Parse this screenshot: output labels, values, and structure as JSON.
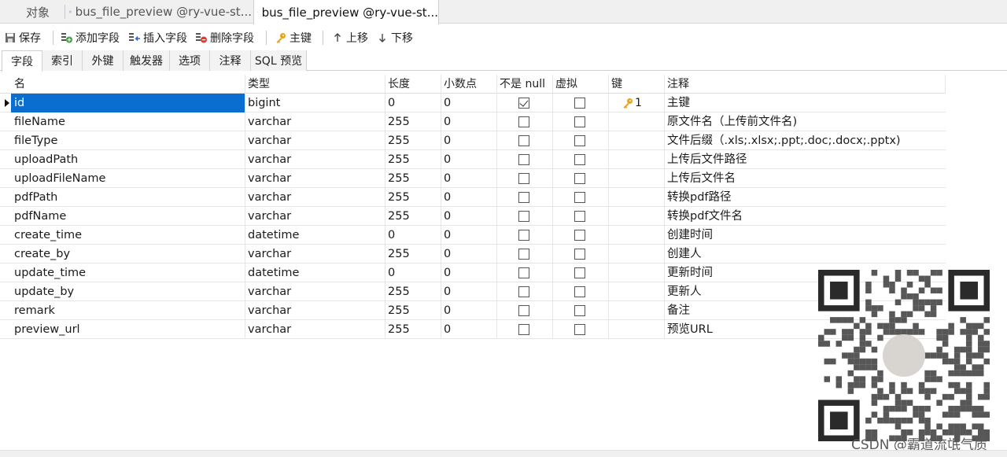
{
  "doc_tabs": [
    {
      "label": "对象",
      "icon": "none"
    },
    {
      "label": "bus_file_preview @ry-vue-st...",
      "icon": "table-icon"
    },
    {
      "label": "bus_file_preview @ry-vue-st...",
      "icon": "table-edit-icon"
    }
  ],
  "toolbar": {
    "save": "保存",
    "add_field": "添加字段",
    "insert_field": "插入字段",
    "delete_field": "删除字段",
    "primary_key": "主键",
    "move_up": "上移",
    "move_down": "下移"
  },
  "section_tabs": [
    "字段",
    "索引",
    "外键",
    "触发器",
    "选项",
    "注释",
    "SQL 预览"
  ],
  "grid": {
    "headers": [
      "名",
      "类型",
      "长度",
      "小数点",
      "不是 null",
      "虚拟",
      "键",
      "注释"
    ],
    "rows": [
      {
        "name": "id",
        "type": "bigint",
        "length": "0",
        "decimals": "0",
        "not_null": true,
        "virtual": false,
        "key": "1",
        "comment": "主键"
      },
      {
        "name": "fileName",
        "type": "varchar",
        "length": "255",
        "decimals": "0",
        "not_null": false,
        "virtual": false,
        "key": "",
        "comment": "原文件名（上传前文件名)"
      },
      {
        "name": "fileType",
        "type": "varchar",
        "length": "255",
        "decimals": "0",
        "not_null": false,
        "virtual": false,
        "key": "",
        "comment": "文件后缀（.xls;.xlsx;.ppt;.doc;.docx;.pptx)"
      },
      {
        "name": "uploadPath",
        "type": "varchar",
        "length": "255",
        "decimals": "0",
        "not_null": false,
        "virtual": false,
        "key": "",
        "comment": "上传后文件路径"
      },
      {
        "name": "uploadFileName",
        "type": "varchar",
        "length": "255",
        "decimals": "0",
        "not_null": false,
        "virtual": false,
        "key": "",
        "comment": "上传后文件名"
      },
      {
        "name": "pdfPath",
        "type": "varchar",
        "length": "255",
        "decimals": "0",
        "not_null": false,
        "virtual": false,
        "key": "",
        "comment": "转换pdf路径"
      },
      {
        "name": "pdfName",
        "type": "varchar",
        "length": "255",
        "decimals": "0",
        "not_null": false,
        "virtual": false,
        "key": "",
        "comment": "转换pdf文件名"
      },
      {
        "name": "create_time",
        "type": "datetime",
        "length": "0",
        "decimals": "0",
        "not_null": false,
        "virtual": false,
        "key": "",
        "comment": "创建时间"
      },
      {
        "name": "create_by",
        "type": "varchar",
        "length": "255",
        "decimals": "0",
        "not_null": false,
        "virtual": false,
        "key": "",
        "comment": "创建人"
      },
      {
        "name": "update_time",
        "type": "datetime",
        "length": "0",
        "decimals": "0",
        "not_null": false,
        "virtual": false,
        "key": "",
        "comment": "更新时间"
      },
      {
        "name": "update_by",
        "type": "varchar",
        "length": "255",
        "decimals": "0",
        "not_null": false,
        "virtual": false,
        "key": "",
        "comment": "更新人"
      },
      {
        "name": "remark",
        "type": "varchar",
        "length": "255",
        "decimals": "0",
        "not_null": false,
        "virtual": false,
        "key": "",
        "comment": "备注"
      },
      {
        "name": "preview_url",
        "type": "varchar",
        "length": "255",
        "decimals": "0",
        "not_null": false,
        "virtual": false,
        "key": "",
        "comment": "预览URL"
      }
    ]
  },
  "watermark": {
    "credit": "CSDN @霸道流氓气质",
    "icon": "qr-code-icon"
  },
  "colors": {
    "selection": "#0a6ed1",
    "key_icon": "#e8a317"
  }
}
